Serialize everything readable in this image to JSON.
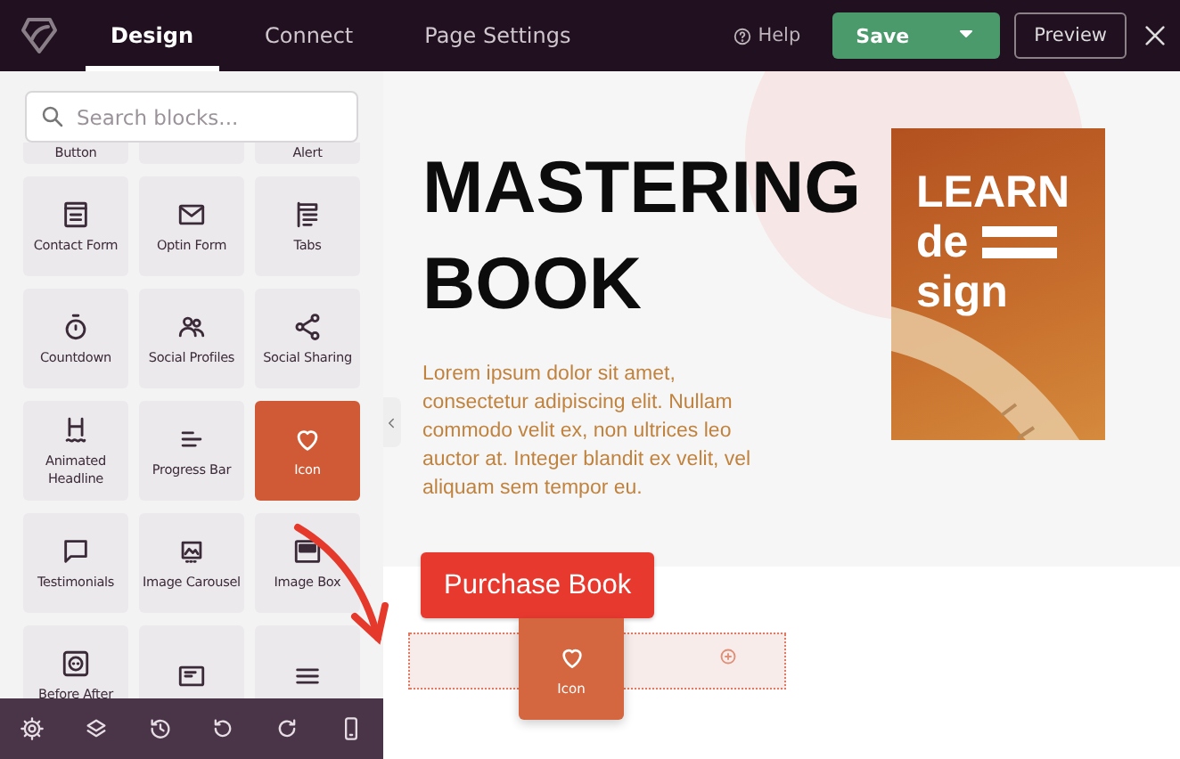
{
  "top_bar": {
    "tabs": [
      {
        "label": "Design",
        "selected": true
      },
      {
        "label": "Connect",
        "selected": false
      },
      {
        "label": "Page Settings",
        "selected": false
      }
    ],
    "help": "Help",
    "save": "Save",
    "preview": "Preview"
  },
  "sidebar": {
    "search": {
      "placeholder": "Search blocks..."
    },
    "blocks": [
      {
        "label": "Button",
        "selected": false
      },
      {
        "selected": false
      },
      {
        "label": "Alert",
        "selected": false
      },
      {
        "label": "Contact Form",
        "selected": false
      },
      {
        "label": "Optin Form",
        "selected": false
      },
      {
        "label": "Tabs",
        "selected": false
      },
      {
        "label": "Countdown",
        "selected": false
      },
      {
        "label": "Social Profiles",
        "selected": false
      },
      {
        "label": "Social Sharing",
        "selected": false
      },
      {
        "label": "Animated Headline",
        "selected": false
      },
      {
        "label": "Progress Bar",
        "selected": false
      },
      {
        "label": "Icon",
        "selected": true
      },
      {
        "label": "Testimonials",
        "selected": false
      },
      {
        "label": "Image Carousel",
        "selected": false
      },
      {
        "label": "Image Box",
        "selected": false
      },
      {
        "label": "Before After",
        "selected": false
      },
      {
        "selected": false
      },
      {
        "selected": false
      }
    ]
  },
  "canvas": {
    "heading": "MASTERING BOOK",
    "paragraph": "Lorem ipsum dolor sit amet, consectetur adipiscing elit. Nullam commodo velit ex, non ultrices leo auctor at. Integer blandit ex velit, vel aliquam sem tempor eu.",
    "book_cover": {
      "lines": [
        "LEARN",
        "de",
        "sign"
      ]
    },
    "button": "Purchase Book",
    "dragged_block": {
      "label": "Icon"
    }
  }
}
